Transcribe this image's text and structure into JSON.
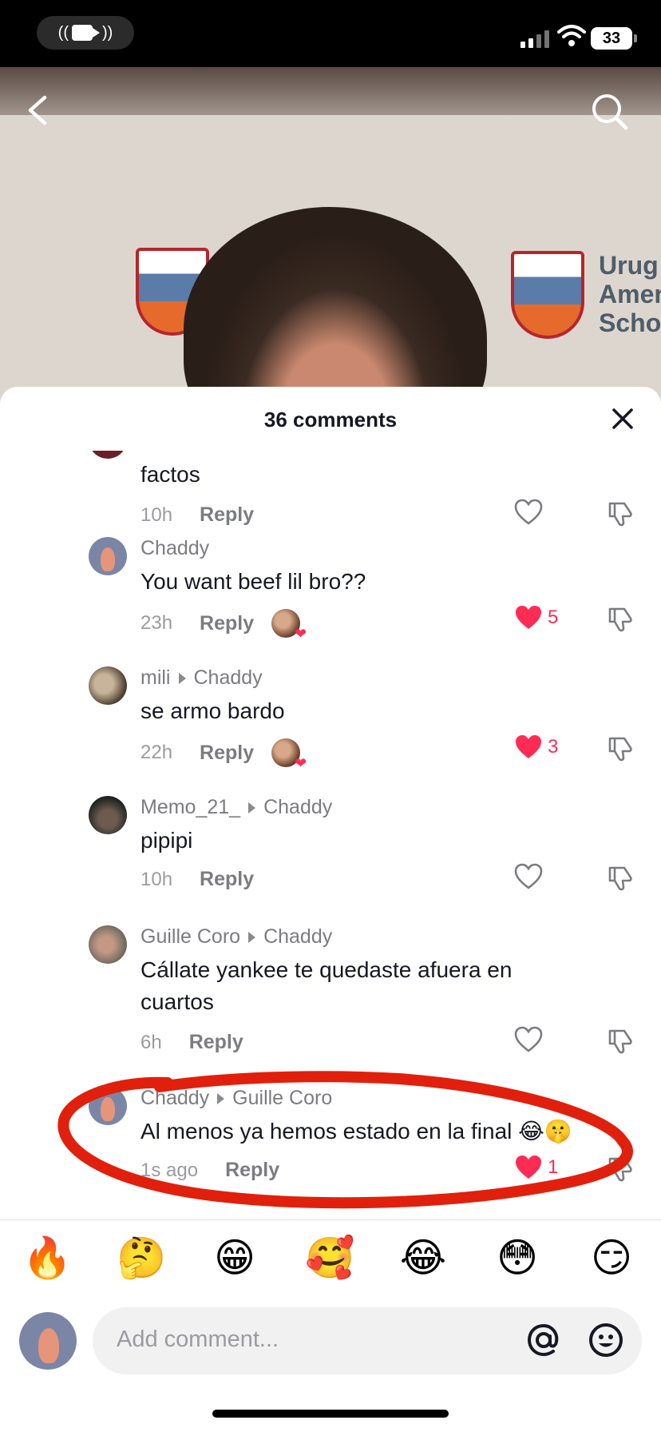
{
  "status_bar": {
    "battery": "33",
    "recording_icon": "screen-recording-icon"
  },
  "video": {
    "logo_text": "Urug\nAmer\nScho"
  },
  "sheet": {
    "title": "36 comments"
  },
  "comments": [
    {
      "username": "",
      "reply_to": "",
      "text": "factos",
      "time": "10h",
      "reply_label": "Reply",
      "liked": false,
      "likes": ""
    },
    {
      "username": "Chaddy",
      "reply_to": "",
      "text": "You want beef lil bro??",
      "time": "23h",
      "reply_label": "Reply",
      "liked": true,
      "likes": "5",
      "creator_liked": true
    },
    {
      "username": "mili",
      "reply_to": "Chaddy",
      "text": "se armo bardo",
      "time": "22h",
      "reply_label": "Reply",
      "liked": true,
      "likes": "3",
      "creator_liked": true
    },
    {
      "username": "Memo_21_",
      "reply_to": "Chaddy",
      "text": "pipipi",
      "time": "10h",
      "reply_label": "Reply",
      "liked": false,
      "likes": ""
    },
    {
      "username": "Guille Coro",
      "reply_to": "Chaddy",
      "text": "Cállate yankee te quedaste afuera en cuartos",
      "time": "6h",
      "reply_label": "Reply",
      "liked": false,
      "likes": ""
    },
    {
      "username": "Chaddy",
      "reply_to": "Guille Coro",
      "text": "Al menos ya hemos estado en la final 😂🤫",
      "time": "1s ago",
      "reply_label": "Reply",
      "liked": true,
      "likes": "1"
    }
  ],
  "emoji_bar": [
    "🔥",
    "🤔",
    "😁",
    "🥰",
    "😂",
    "😳",
    "😏"
  ],
  "input": {
    "placeholder": "Add comment..."
  },
  "colors": {
    "like_red": "#fe2c55",
    "annotation_red": "#e0200c",
    "text_dark": "#161823",
    "text_gray": "#7b7c81"
  }
}
